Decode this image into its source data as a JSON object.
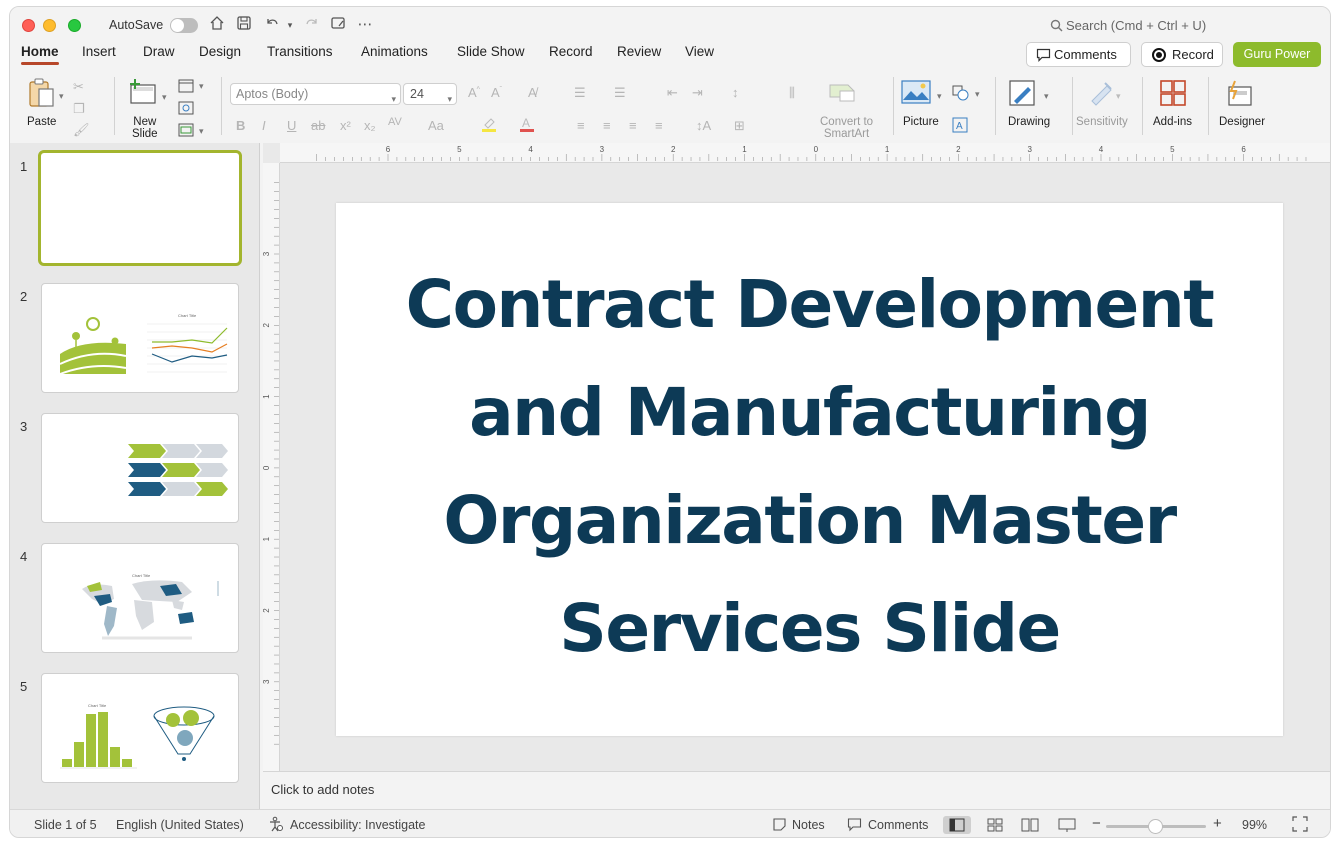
{
  "titlebar": {
    "autosave_label": "AutoSave",
    "search_placeholder": "Search (Cmd + Ctrl + U)"
  },
  "tabs": [
    {
      "label": "Home",
      "active": true
    },
    {
      "label": "Insert"
    },
    {
      "label": "Draw"
    },
    {
      "label": "Design"
    },
    {
      "label": "Transitions"
    },
    {
      "label": "Animations"
    },
    {
      "label": "Slide Show"
    },
    {
      "label": "Record"
    },
    {
      "label": "Review"
    },
    {
      "label": "View"
    }
  ],
  "actions": {
    "comments": "Comments",
    "record": "Record",
    "guru": "Guru Power"
  },
  "ribbon": {
    "paste": "Paste",
    "new_slide": "New\nSlide",
    "font_name": "Aptos (Body)",
    "font_size": "24",
    "convert_smartart": "Convert to\nSmartArt",
    "picture": "Picture",
    "drawing": "Drawing",
    "sensitivity": "Sensitivity",
    "addins": "Add-ins",
    "designer": "Designer"
  },
  "rulers": {
    "h_labels": [
      "6",
      "5",
      "4",
      "3",
      "2",
      "1",
      "0",
      "1",
      "2",
      "3",
      "4",
      "5",
      "6"
    ],
    "v_labels": [
      "3",
      "2",
      "1",
      "0",
      "1",
      "2",
      "3"
    ]
  },
  "thumbnails": [
    {
      "num": "1",
      "selected": true
    },
    {
      "num": "2",
      "chart_title": "Chart Title"
    },
    {
      "num": "3"
    },
    {
      "num": "4",
      "chart_title": "Chart Title"
    },
    {
      "num": "5",
      "chart_title": "Chart Title"
    }
  ],
  "slide": {
    "title": "Contract Development and Manufacturing Organization Master Services Slide"
  },
  "notes": {
    "placeholder": "Click to add notes"
  },
  "status": {
    "slide_indicator": "Slide 1 of 5",
    "language": "English (United States)",
    "accessibility": "Accessibility: Investigate",
    "notes": "Notes",
    "comments": "Comments",
    "zoom": "99%",
    "zoom_level": 0.99
  },
  "colors": {
    "title_text": "#0d3a56",
    "accent_green": "#8dbb2c",
    "thumbnail_selected": "#a3b52e",
    "tab_underline": "#b7472a",
    "chevron_blue": "#1f5c82"
  }
}
